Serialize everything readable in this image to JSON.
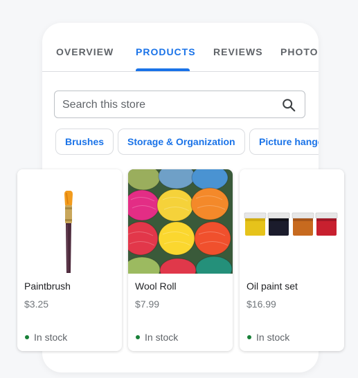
{
  "tabs": [
    {
      "label": "OVERVIEW",
      "active": false
    },
    {
      "label": "PRODUCTS",
      "active": true
    },
    {
      "label": "REVIEWS",
      "active": false
    },
    {
      "label": "PHOTOS",
      "active": false
    }
  ],
  "search": {
    "placeholder": "Search this store"
  },
  "chips": [
    "Brushes",
    "Storage & Organization",
    "Picture hangers"
  ],
  "products": [
    {
      "name": "Paintbrush",
      "price": "$3.25",
      "status": "In stock",
      "image": "paintbrush"
    },
    {
      "name": "Wool Roll",
      "price": "$7.99",
      "status": "In stock",
      "image": "wool-yarn"
    },
    {
      "name": "Oil paint set",
      "price": "$16.99",
      "status": "In stock",
      "image": "paint-jars"
    }
  ],
  "colors": {
    "accent": "#1a73e8",
    "in_stock": "#188038"
  }
}
